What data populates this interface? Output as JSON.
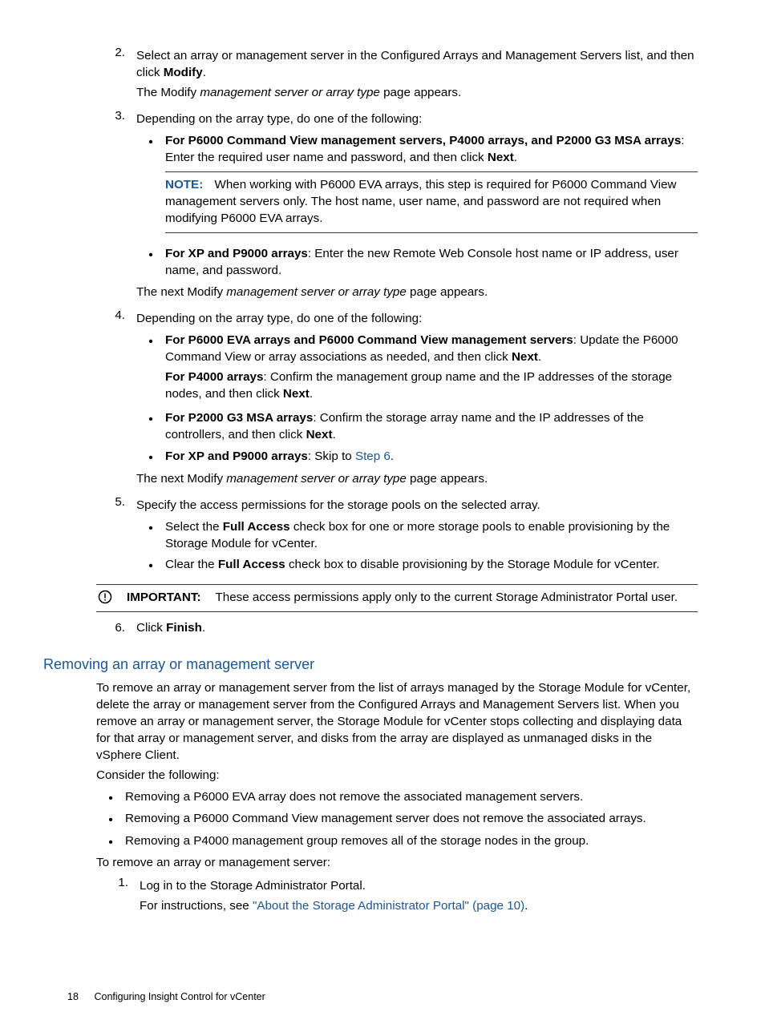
{
  "steps": {
    "s2": {
      "num": "2.",
      "text_a": "Select an array or management server in the Configured Arrays and Management Servers list, and then click ",
      "text_b": "Modify",
      "text_c": ".",
      "sub_a": "The Modify ",
      "sub_b": "management server or array type",
      "sub_c": " page appears."
    },
    "s3": {
      "num": "3.",
      "text": "Depending on the array type, do one of the following:",
      "b1_a": "For P6000 Command View management servers, P4000 arrays, and P2000 G3 MSA arrays",
      "b1_b": ": Enter the required user name and password, and then click ",
      "b1_c": "Next",
      "b1_d": ".",
      "note_label": "NOTE:",
      "note_text": "When working with P6000 EVA arrays, this step is required for P6000 Command View management servers only. The host name, user name, and password are not required when modifying P6000 EVA arrays.",
      "b2_a": "For XP and P9000 arrays",
      "b2_b": ": Enter the new Remote Web Console host name or IP address, user name, and password.",
      "tail_a": "The next Modify ",
      "tail_b": "management server or array type",
      "tail_c": " page appears."
    },
    "s4": {
      "num": "4.",
      "text": "Depending on the array type, do one of the following:",
      "b1_a": "For P6000 EVA arrays and P6000 Command View management servers",
      "b1_b": ": Update the P6000 Command View or array associations as needed, and then click ",
      "b1_c": "Next",
      "b1_d": ".",
      "b1s_a": "For P4000 arrays",
      "b1s_b": ": Confirm the management group name and the IP addresses of the storage nodes, and then click ",
      "b1s_c": "Next",
      "b1s_d": ".",
      "b2_a": "For P2000 G3 MSA arrays",
      "b2_b": ": Confirm the storage array name and the IP addresses of the controllers, and then click ",
      "b2_c": "Next",
      "b2_d": ".",
      "b3_a": "For XP and P9000 arrays",
      "b3_b": ": Skip to ",
      "b3_link": "Step 6",
      "b3_c": ".",
      "tail_a": "The next Modify ",
      "tail_b": "management server or array type",
      "tail_c": " page appears."
    },
    "s5": {
      "num": "5.",
      "text": "Specify the access permissions for the storage pools on the selected array.",
      "b1_a": "Select the ",
      "b1_b": "Full Access",
      "b1_c": " check box for one or more storage pools to enable provisioning by the Storage Module for vCenter.",
      "b2_a": "Clear the ",
      "b2_b": "Full Access",
      "b2_c": " check box to disable provisioning by the Storage Module for vCenter."
    },
    "s6": {
      "num": "6.",
      "text_a": "Click ",
      "text_b": "Finish",
      "text_c": "."
    }
  },
  "important": {
    "label": "IMPORTANT:",
    "text": "These access permissions apply only to the current Storage Administrator Portal user."
  },
  "section2": {
    "heading": "Removing an array or management server",
    "p1": "To remove an array or management server from the list of arrays managed by the Storage Module for vCenter, delete the array or management server from the Configured Arrays and Management Servers list. When you remove an array or management server, the Storage Module for vCenter stops collecting and displaying data for that array or management server, and disks from the array are displayed as unmanaged disks in the vSphere Client.",
    "p2": "Consider the following:",
    "b1": "Removing a P6000 EVA array does not remove the associated management servers.",
    "b2": "Removing a P6000 Command View management server does not remove the associated arrays.",
    "b3": "Removing a P4000 management group removes all of the storage nodes in the group.",
    "p3": "To remove an array or management server:",
    "s1_num": "1.",
    "s1_text": "Log in to the Storage Administrator Portal.",
    "s1_sub_a": "For instructions, see ",
    "s1_link": "\"About the Storage Administrator Portal\" (page 10)",
    "s1_sub_b": "."
  },
  "footer": {
    "page": "18",
    "title": "Configuring Insight Control for vCenter"
  }
}
